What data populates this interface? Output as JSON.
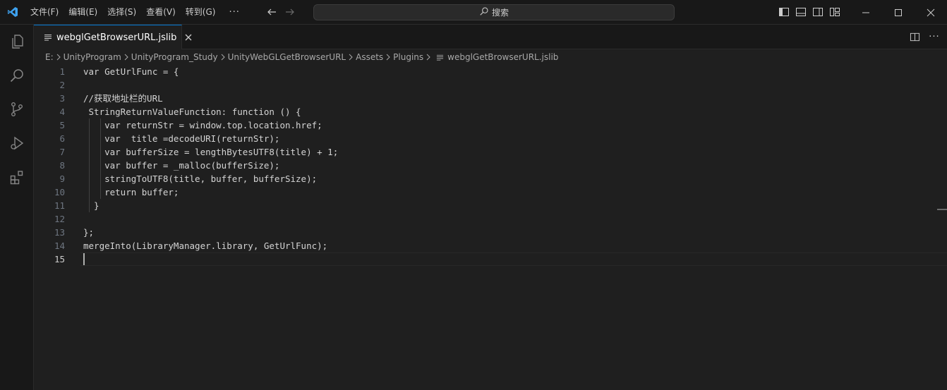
{
  "titlebar": {
    "menu": [
      "文件(F)",
      "编辑(E)",
      "选择(S)",
      "查看(V)",
      "转到(G)"
    ],
    "more": "···",
    "search_label": "搜索",
    "colors": {
      "accent": "#0078d4",
      "logo": "#3ea2f0"
    }
  },
  "tabs": [
    {
      "label": "webglGetBrowserURL.jslib",
      "active": true
    }
  ],
  "tab_actions": {
    "more": "···"
  },
  "breadcrumb": {
    "items": [
      "E:",
      "UnityProgram",
      "UnityProgram_Study",
      "UnityWebGLGetBrowserURL",
      "Assets",
      "Plugins"
    ],
    "file": "webglGetBrowserURL.jslib"
  },
  "editor": {
    "active_line": 15,
    "lines": [
      {
        "n": "1",
        "text": "var GetUrlFunc = {"
      },
      {
        "n": "2",
        "text": ""
      },
      {
        "n": "3",
        "text": "//获取地址栏的URL"
      },
      {
        "n": "4",
        "text": " StringReturnValueFunction: function () {"
      },
      {
        "n": "5",
        "text": "    var returnStr = window.top.location.href;"
      },
      {
        "n": "6",
        "text": "    var  title =decodeURI(returnStr);"
      },
      {
        "n": "7",
        "text": "    var bufferSize = lengthBytesUTF8(title) + 1;"
      },
      {
        "n": "8",
        "text": "    var buffer = _malloc(bufferSize);"
      },
      {
        "n": "9",
        "text": "    stringToUTF8(title, buffer, bufferSize);"
      },
      {
        "n": "10",
        "text": "    return buffer;"
      },
      {
        "n": "11",
        "text": "  }"
      },
      {
        "n": "12",
        "text": ""
      },
      {
        "n": "13",
        "text": "};"
      },
      {
        "n": "14",
        "text": "mergeInto(LibraryManager.library, GetUrlFunc);"
      },
      {
        "n": "15",
        "text": ""
      }
    ]
  }
}
